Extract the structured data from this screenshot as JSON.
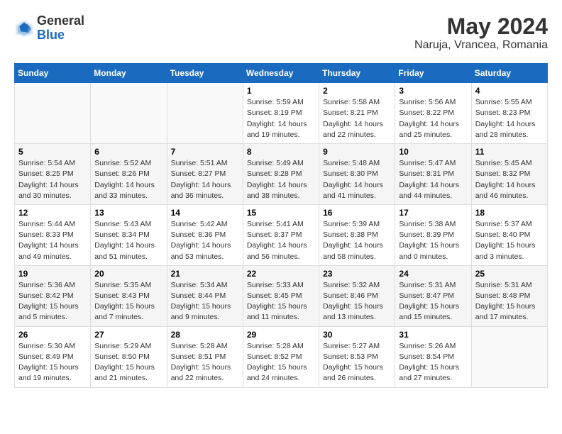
{
  "header": {
    "logo_general": "General",
    "logo_blue": "Blue",
    "month_year": "May 2024",
    "location": "Naruja, Vrancea, Romania"
  },
  "days_of_week": [
    "Sunday",
    "Monday",
    "Tuesday",
    "Wednesday",
    "Thursday",
    "Friday",
    "Saturday"
  ],
  "weeks": [
    [
      {
        "day": "",
        "sunrise": "",
        "sunset": "",
        "daylight": ""
      },
      {
        "day": "",
        "sunrise": "",
        "sunset": "",
        "daylight": ""
      },
      {
        "day": "",
        "sunrise": "",
        "sunset": "",
        "daylight": ""
      },
      {
        "day": "1",
        "sunrise": "Sunrise: 5:59 AM",
        "sunset": "Sunset: 8:19 PM",
        "daylight": "Daylight: 14 hours and 19 minutes."
      },
      {
        "day": "2",
        "sunrise": "Sunrise: 5:58 AM",
        "sunset": "Sunset: 8:21 PM",
        "daylight": "Daylight: 14 hours and 22 minutes."
      },
      {
        "day": "3",
        "sunrise": "Sunrise: 5:56 AM",
        "sunset": "Sunset: 8:22 PM",
        "daylight": "Daylight: 14 hours and 25 minutes."
      },
      {
        "day": "4",
        "sunrise": "Sunrise: 5:55 AM",
        "sunset": "Sunset: 8:23 PM",
        "daylight": "Daylight: 14 hours and 28 minutes."
      }
    ],
    [
      {
        "day": "5",
        "sunrise": "Sunrise: 5:54 AM",
        "sunset": "Sunset: 8:25 PM",
        "daylight": "Daylight: 14 hours and 30 minutes."
      },
      {
        "day": "6",
        "sunrise": "Sunrise: 5:52 AM",
        "sunset": "Sunset: 8:26 PM",
        "daylight": "Daylight: 14 hours and 33 minutes."
      },
      {
        "day": "7",
        "sunrise": "Sunrise: 5:51 AM",
        "sunset": "Sunset: 8:27 PM",
        "daylight": "Daylight: 14 hours and 36 minutes."
      },
      {
        "day": "8",
        "sunrise": "Sunrise: 5:49 AM",
        "sunset": "Sunset: 8:28 PM",
        "daylight": "Daylight: 14 hours and 38 minutes."
      },
      {
        "day": "9",
        "sunrise": "Sunrise: 5:48 AM",
        "sunset": "Sunset: 8:30 PM",
        "daylight": "Daylight: 14 hours and 41 minutes."
      },
      {
        "day": "10",
        "sunrise": "Sunrise: 5:47 AM",
        "sunset": "Sunset: 8:31 PM",
        "daylight": "Daylight: 14 hours and 44 minutes."
      },
      {
        "day": "11",
        "sunrise": "Sunrise: 5:45 AM",
        "sunset": "Sunset: 8:32 PM",
        "daylight": "Daylight: 14 hours and 46 minutes."
      }
    ],
    [
      {
        "day": "12",
        "sunrise": "Sunrise: 5:44 AM",
        "sunset": "Sunset: 8:33 PM",
        "daylight": "Daylight: 14 hours and 49 minutes."
      },
      {
        "day": "13",
        "sunrise": "Sunrise: 5:43 AM",
        "sunset": "Sunset: 8:34 PM",
        "daylight": "Daylight: 14 hours and 51 minutes."
      },
      {
        "day": "14",
        "sunrise": "Sunrise: 5:42 AM",
        "sunset": "Sunset: 8:36 PM",
        "daylight": "Daylight: 14 hours and 53 minutes."
      },
      {
        "day": "15",
        "sunrise": "Sunrise: 5:41 AM",
        "sunset": "Sunset: 8:37 PM",
        "daylight": "Daylight: 14 hours and 56 minutes."
      },
      {
        "day": "16",
        "sunrise": "Sunrise: 5:39 AM",
        "sunset": "Sunset: 8:38 PM",
        "daylight": "Daylight: 14 hours and 58 minutes."
      },
      {
        "day": "17",
        "sunrise": "Sunrise: 5:38 AM",
        "sunset": "Sunset: 8:39 PM",
        "daylight": "Daylight: 15 hours and 0 minutes."
      },
      {
        "day": "18",
        "sunrise": "Sunrise: 5:37 AM",
        "sunset": "Sunset: 8:40 PM",
        "daylight": "Daylight: 15 hours and 3 minutes."
      }
    ],
    [
      {
        "day": "19",
        "sunrise": "Sunrise: 5:36 AM",
        "sunset": "Sunset: 8:42 PM",
        "daylight": "Daylight: 15 hours and 5 minutes."
      },
      {
        "day": "20",
        "sunrise": "Sunrise: 5:35 AM",
        "sunset": "Sunset: 8:43 PM",
        "daylight": "Daylight: 15 hours and 7 minutes."
      },
      {
        "day": "21",
        "sunrise": "Sunrise: 5:34 AM",
        "sunset": "Sunset: 8:44 PM",
        "daylight": "Daylight: 15 hours and 9 minutes."
      },
      {
        "day": "22",
        "sunrise": "Sunrise: 5:33 AM",
        "sunset": "Sunset: 8:45 PM",
        "daylight": "Daylight: 15 hours and 11 minutes."
      },
      {
        "day": "23",
        "sunrise": "Sunrise: 5:32 AM",
        "sunset": "Sunset: 8:46 PM",
        "daylight": "Daylight: 15 hours and 13 minutes."
      },
      {
        "day": "24",
        "sunrise": "Sunrise: 5:31 AM",
        "sunset": "Sunset: 8:47 PM",
        "daylight": "Daylight: 15 hours and 15 minutes."
      },
      {
        "day": "25",
        "sunrise": "Sunrise: 5:31 AM",
        "sunset": "Sunset: 8:48 PM",
        "daylight": "Daylight: 15 hours and 17 minutes."
      }
    ],
    [
      {
        "day": "26",
        "sunrise": "Sunrise: 5:30 AM",
        "sunset": "Sunset: 8:49 PM",
        "daylight": "Daylight: 15 hours and 19 minutes."
      },
      {
        "day": "27",
        "sunrise": "Sunrise: 5:29 AM",
        "sunset": "Sunset: 8:50 PM",
        "daylight": "Daylight: 15 hours and 21 minutes."
      },
      {
        "day": "28",
        "sunrise": "Sunrise: 5:28 AM",
        "sunset": "Sunset: 8:51 PM",
        "daylight": "Daylight: 15 hours and 22 minutes."
      },
      {
        "day": "29",
        "sunrise": "Sunrise: 5:28 AM",
        "sunset": "Sunset: 8:52 PM",
        "daylight": "Daylight: 15 hours and 24 minutes."
      },
      {
        "day": "30",
        "sunrise": "Sunrise: 5:27 AM",
        "sunset": "Sunset: 8:53 PM",
        "daylight": "Daylight: 15 hours and 26 minutes."
      },
      {
        "day": "31",
        "sunrise": "Sunrise: 5:26 AM",
        "sunset": "Sunset: 8:54 PM",
        "daylight": "Daylight: 15 hours and 27 minutes."
      },
      {
        "day": "",
        "sunrise": "",
        "sunset": "",
        "daylight": ""
      }
    ]
  ]
}
